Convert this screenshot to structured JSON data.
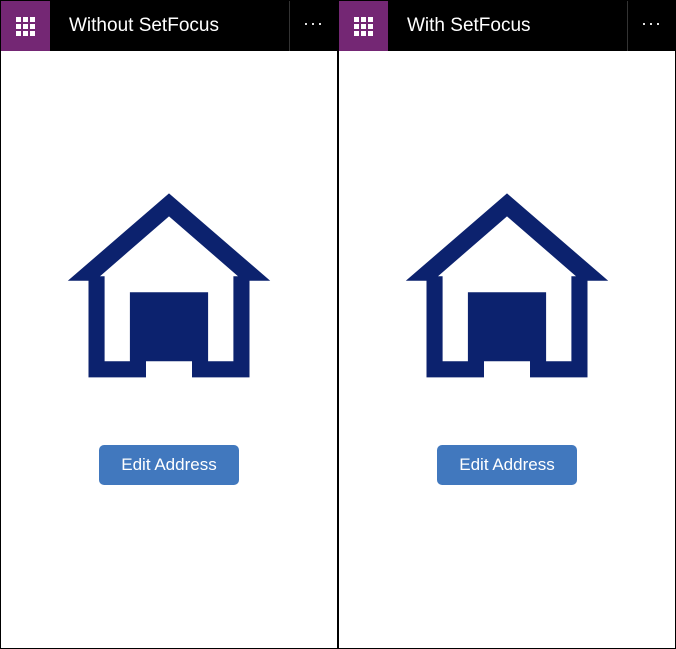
{
  "panes": [
    {
      "title": "Without SetFocus",
      "button_label": "Edit Address"
    },
    {
      "title": "With SetFocus",
      "button_label": "Edit Address"
    }
  ],
  "colors": {
    "accent": "#742774",
    "button": "#4178be",
    "icon": "#0c226e"
  }
}
